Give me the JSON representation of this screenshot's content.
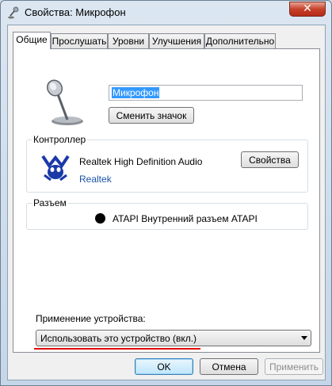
{
  "window": {
    "title": "Свойства: Микрофон",
    "close_label": "✕"
  },
  "tabs": [
    {
      "label": "Общие",
      "active": true
    },
    {
      "label": "Прослушать",
      "active": false
    },
    {
      "label": "Уровни",
      "active": false
    },
    {
      "label": "Улучшения",
      "active": false
    },
    {
      "label": "Дополнительно",
      "active": false
    }
  ],
  "general": {
    "device_name_value": "Микрофон",
    "change_icon_label": "Сменить значок",
    "controller": {
      "group_label": "Контроллер",
      "device": "Realtek High Definition Audio",
      "vendor": "Realtek",
      "properties_label": "Свойства"
    },
    "jack": {
      "group_label": "Разъем",
      "description": "ATAPI Внутренний разъем ATAPI",
      "color": "#000000"
    },
    "device_usage": {
      "label": "Применение устройства:",
      "selected": "Использовать это устройство (вкл.)"
    }
  },
  "footer": {
    "ok_label": "OK",
    "cancel_label": "Отмена",
    "apply_label": "Применить",
    "apply_enabled": false
  },
  "colors": {
    "annotation_red": "#e00000",
    "link_blue": "#1a52a8",
    "highlight": "#3399ff"
  }
}
